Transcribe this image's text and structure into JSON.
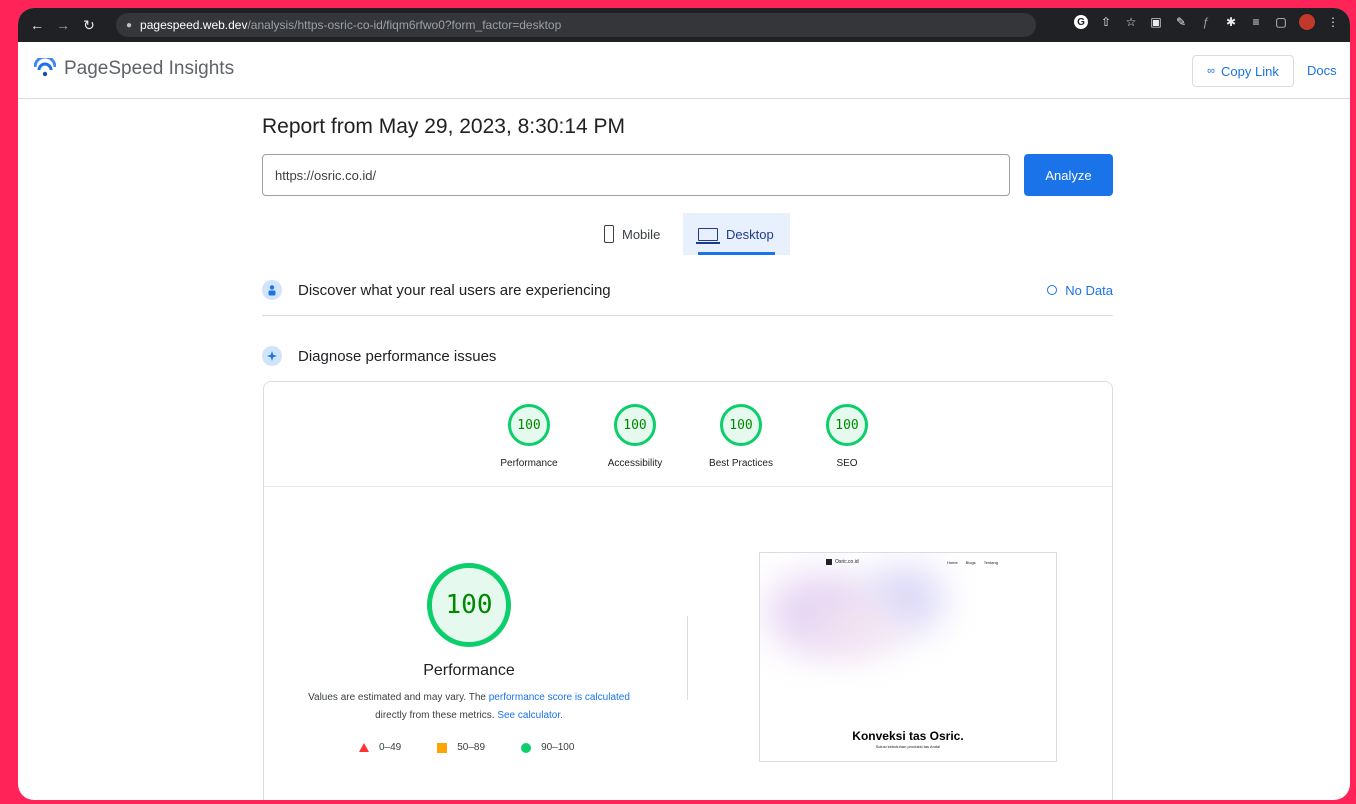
{
  "browser": {
    "url_host": "pagespeed.web.dev",
    "url_path": "/analysis/https-osric-co-id/fiqm6rfwo0?form_factor=desktop"
  },
  "header": {
    "title": "PageSpeed Insights",
    "copy_link_label": "Copy Link",
    "docs_label": "Docs"
  },
  "report": {
    "title": "Report from May 29, 2023, 8:30:14 PM",
    "url_value": "https://osric.co.id/",
    "analyze_label": "Analyze"
  },
  "tabs": {
    "mobile": "Mobile",
    "desktop": "Desktop",
    "selected": "Desktop"
  },
  "sections": {
    "real_users": "Discover what your real users are experiencing",
    "no_data": "No Data",
    "diagnose": "Diagnose performance issues"
  },
  "scores": [
    {
      "label": "Performance",
      "value": "100"
    },
    {
      "label": "Accessibility",
      "value": "100"
    },
    {
      "label": "Best Practices",
      "value": "100"
    },
    {
      "label": "SEO",
      "value": "100"
    }
  ],
  "performance": {
    "score": "100",
    "label": "Performance",
    "desc_1": "Values are estimated and may vary. The ",
    "desc_link_1": "performance score is calculated",
    "desc_2": " directly from these metrics. ",
    "desc_link_2": "See calculator.",
    "legend": [
      {
        "range": "0–49",
        "color": "#ff3333",
        "shape": "triangle"
      },
      {
        "range": "50–89",
        "color": "#ffa400",
        "shape": "square"
      },
      {
        "range": "90–100",
        "color": "#0cce6b",
        "shape": "circle"
      }
    ]
  },
  "preview": {
    "brand": "Osric.co.id",
    "nav": [
      "Home",
      "Blogs",
      "Tentang"
    ],
    "heading": "Konveksi tas Osric.",
    "subheading": "Solusi kebutuhan produksi tas Anda!"
  },
  "colors": {
    "accent": "#1a73e8",
    "pass": "#0cce6b",
    "frame": "#ff2358"
  }
}
